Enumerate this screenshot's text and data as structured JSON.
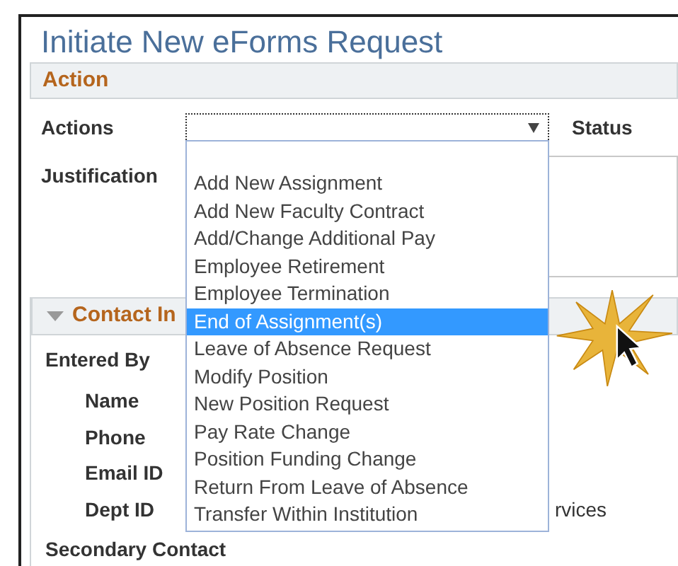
{
  "page_title": "Initiate New eForms Request",
  "action_section": {
    "title": "Action",
    "actions_label": "Actions",
    "status_label": "Status",
    "justification_label": "Justification"
  },
  "dropdown": {
    "items": [
      {
        "label": "Add New Assignment",
        "selected": false
      },
      {
        "label": "Add New Faculty Contract",
        "selected": false
      },
      {
        "label": "Add/Change Additional Pay",
        "selected": false
      },
      {
        "label": "Employee Retirement",
        "selected": false
      },
      {
        "label": "Employee Termination",
        "selected": false
      },
      {
        "label": "End of Assignment(s)",
        "selected": true
      },
      {
        "label": "Leave of Absence Request",
        "selected": false
      },
      {
        "label": "Modify Position",
        "selected": false
      },
      {
        "label": "New Position Request",
        "selected": false
      },
      {
        "label": "Pay Rate Change",
        "selected": false
      },
      {
        "label": "Position Funding Change",
        "selected": false
      },
      {
        "label": "Return From Leave of Absence",
        "selected": false
      },
      {
        "label": "Transfer Within Institution",
        "selected": false
      }
    ]
  },
  "contact_section": {
    "title": "Contact In",
    "expanded": true,
    "entered_by_label": "Entered By",
    "fields": [
      {
        "label": "Name"
      },
      {
        "label": "Phone"
      },
      {
        "label": "Email ID"
      },
      {
        "label": "Dept ID",
        "value": "rvices"
      }
    ],
    "secondary_label": "Secondary Contact"
  }
}
